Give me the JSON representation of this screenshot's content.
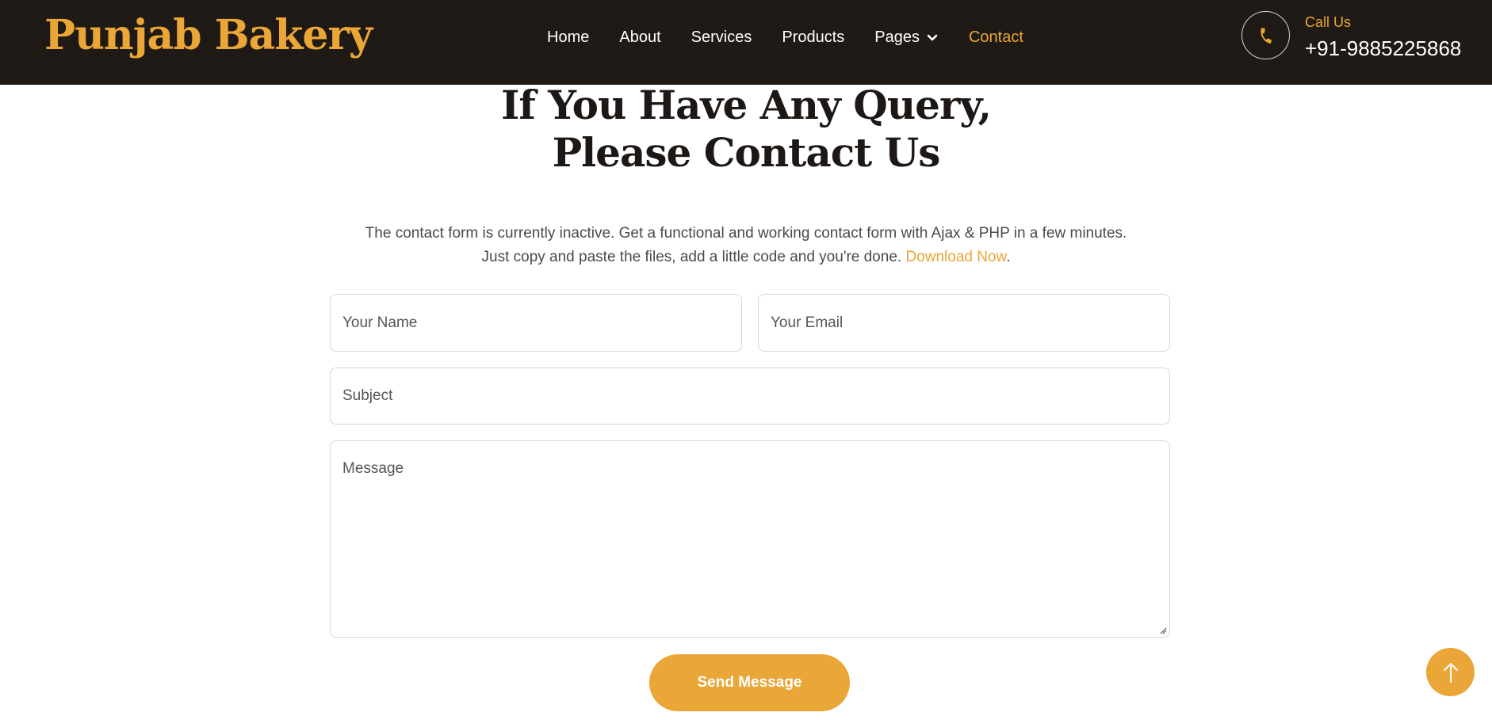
{
  "brand": {
    "name": "Punjab Bakery"
  },
  "nav": {
    "items": [
      {
        "label": "Home"
      },
      {
        "label": "About"
      },
      {
        "label": "Services"
      },
      {
        "label": "Products"
      },
      {
        "label": "Pages",
        "icon": "chevron-down-icon"
      },
      {
        "label": "Contact",
        "active": true
      }
    ]
  },
  "call": {
    "label": "Call Us",
    "number": "+91-9885225868",
    "icon": "phone-icon"
  },
  "contact": {
    "heading_line1": "If You Have Any Query,",
    "heading_line2": "Please Contact Us",
    "intro_line1": "The contact form is currently inactive. Get a functional and working contact form with Ajax & PHP in a few minutes.",
    "intro_line2": "Just copy and paste the files, add a little code and you're done.",
    "download_link": "Download Now",
    "period": "."
  },
  "form": {
    "name_placeholder": "Your Name",
    "email_placeholder": "Your Email",
    "subject_placeholder": "Subject",
    "message_placeholder": "Message",
    "send_label": "Send Message"
  },
  "back_to_top": {
    "icon": "arrow-up-icon"
  },
  "colors": {
    "accent": "#eaa636",
    "nav_bg": "#201a16",
    "heading": "#1d1815"
  }
}
